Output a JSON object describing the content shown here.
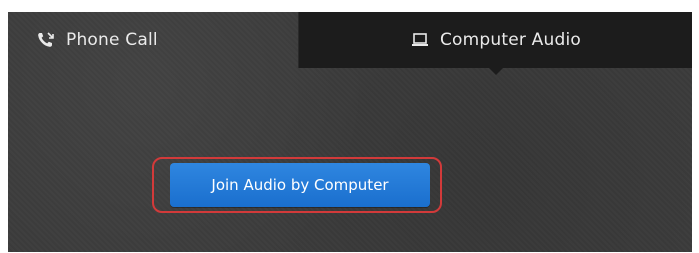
{
  "tabs": {
    "phone": {
      "label": "Phone Call",
      "icon": "phone-call-icon"
    },
    "computer": {
      "label": "Computer Audio",
      "icon": "laptop-icon",
      "selected": true
    }
  },
  "join_button": {
    "label": "Join Audio by Computer",
    "color": "#1f78d6",
    "highlight_color": "#d23a3a"
  }
}
